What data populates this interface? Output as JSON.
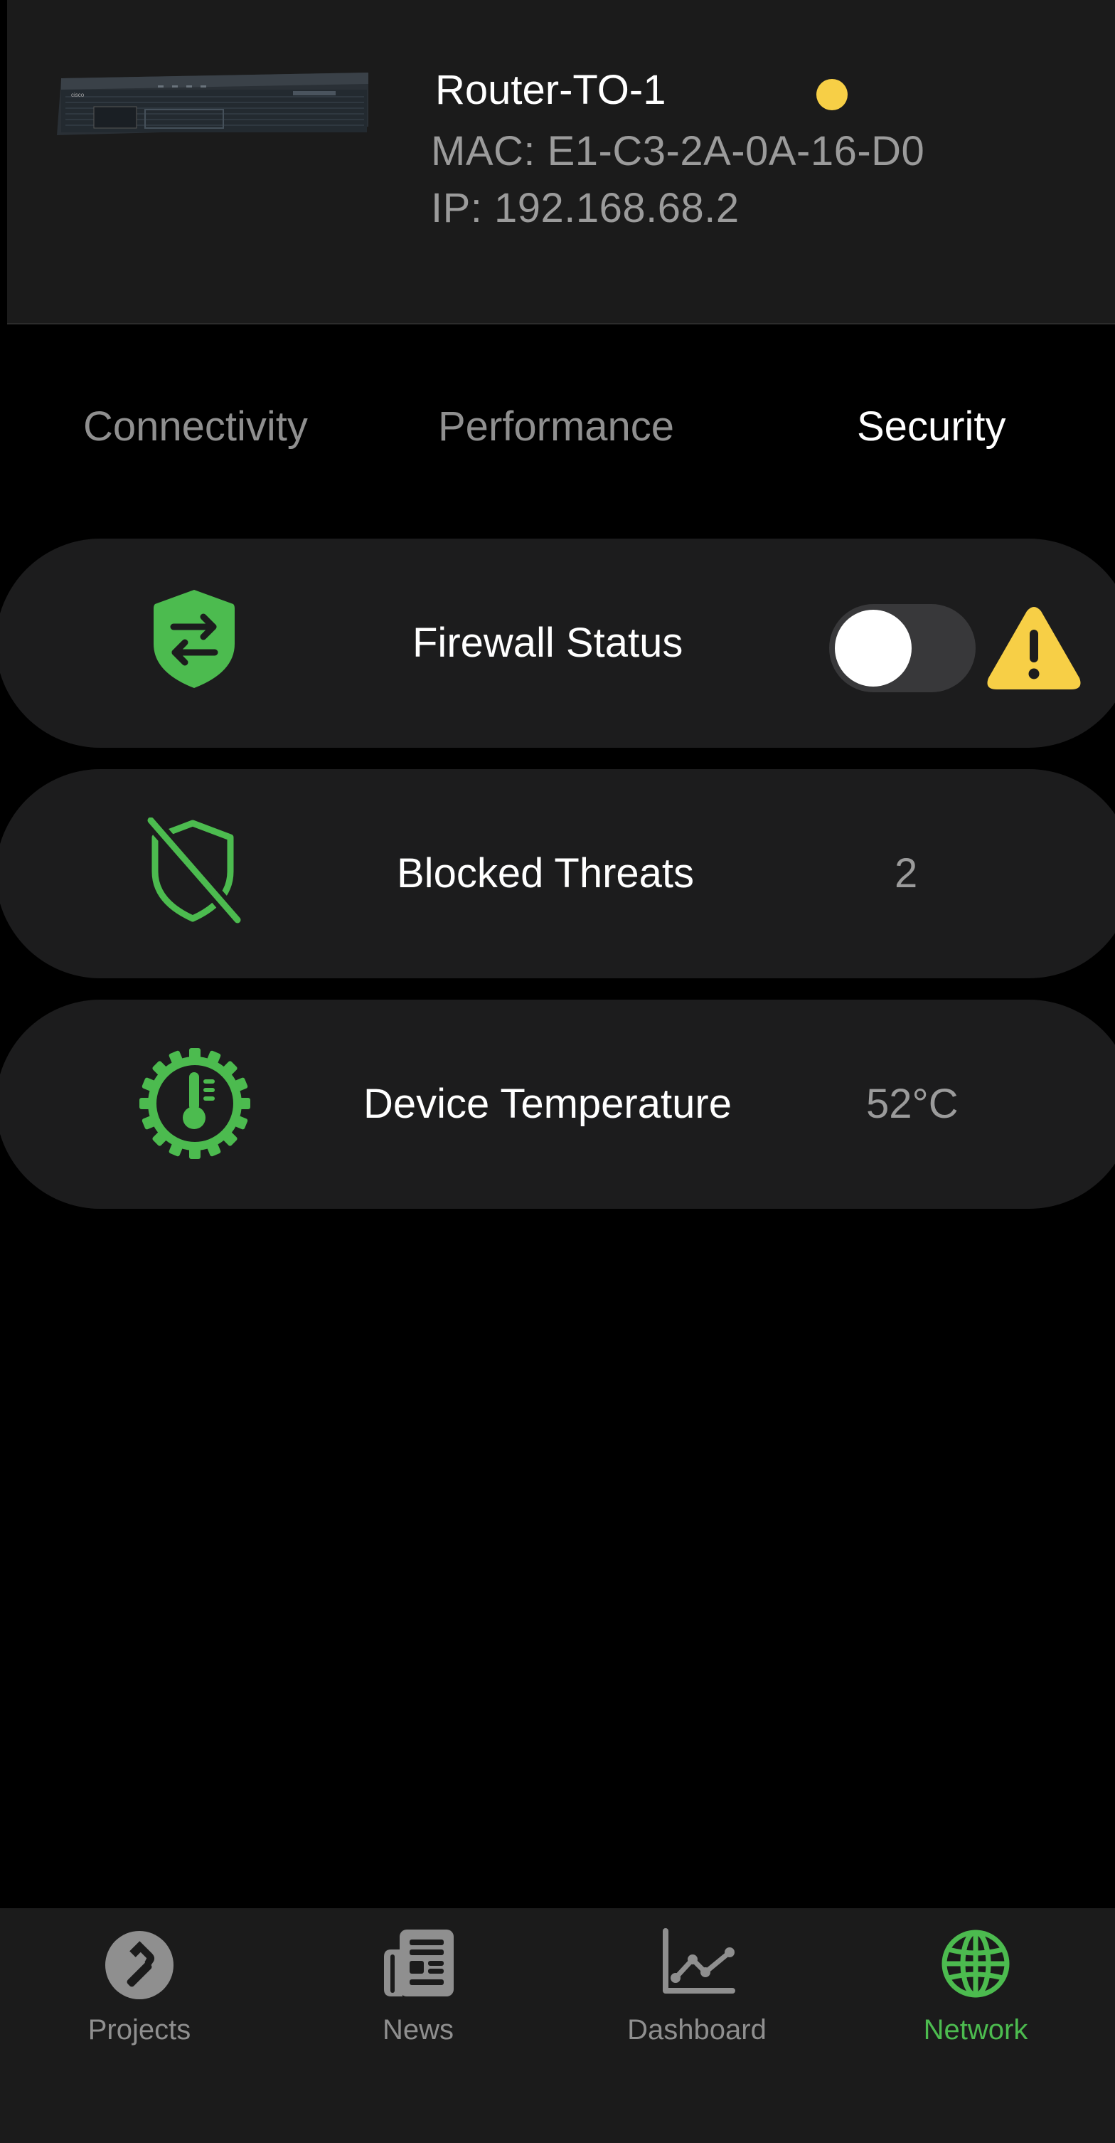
{
  "device": {
    "name": "Router-TO-1",
    "mac": "MAC: E1-C3-2A-0A-16-D0",
    "ip": "IP: 192.168.68.2",
    "status_color": "#f7cf46"
  },
  "tabs": [
    {
      "label": "Connectivity",
      "active": false
    },
    {
      "label": "Performance",
      "active": false
    },
    {
      "label": "Security",
      "active": true
    }
  ],
  "rows": {
    "firewall": {
      "label": "Firewall Status",
      "icon": "shield-arrows-icon",
      "toggle_on": false,
      "warning_icon": "warning-icon"
    },
    "threats": {
      "label": "Blocked Threats",
      "icon": "shield-slash-icon",
      "value": "2"
    },
    "temperature": {
      "label": "Device Temperature",
      "icon": "thermometer-gear-icon",
      "value": "52°C"
    }
  },
  "tab_bar": {
    "items": [
      {
        "label": "Projects",
        "icon": "hammer-icon",
        "active": false
      },
      {
        "label": "News",
        "icon": "newspaper-icon",
        "active": false
      },
      {
        "label": "Dashboard",
        "icon": "chart-icon",
        "active": false
      },
      {
        "label": "Network",
        "icon": "globe-icon",
        "active": true
      }
    ]
  },
  "colors": {
    "accent": "#4cbb4f",
    "warning": "#f7cf46",
    "inactive": "#8f8f8f"
  }
}
